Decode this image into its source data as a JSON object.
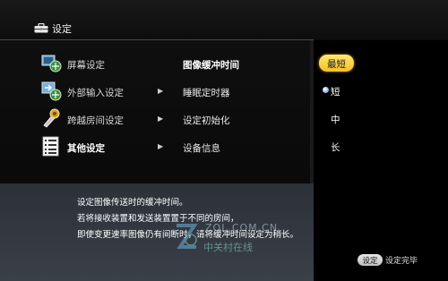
{
  "header": {
    "title": "设定",
    "icon": "toolbox-icon"
  },
  "left_menu": [
    {
      "label": "屏幕设定",
      "icon": "screen-settings-icon"
    },
    {
      "label": "外部输入设定",
      "icon": "input-settings-icon"
    },
    {
      "label": "跨越房间设定",
      "icon": "cross-room-icon"
    },
    {
      "label": "其他设定",
      "icon": "other-settings-icon"
    }
  ],
  "middle_menu": [
    "图像缓冲时间",
    "睡眠定时器",
    "设定初始化",
    "设备信息"
  ],
  "options": {
    "selected": "最短",
    "items": [
      "短",
      "中",
      "长"
    ]
  },
  "description": [
    "设定图像传送时的缓冲时间。",
    "若将接收装置和发送装置置于不同的房间，",
    "即使变更速率图像仍有间断时，请将缓冲时间设定为稍长。"
  ],
  "watermark": {
    "text": "ZOL.COM.CN",
    "cn": "中关村在线"
  },
  "footer": {
    "button_label": "设定",
    "label": "设定完毕"
  },
  "colors": {
    "accent_selected": "#f6bf24",
    "desc_bg": "#343a42"
  }
}
